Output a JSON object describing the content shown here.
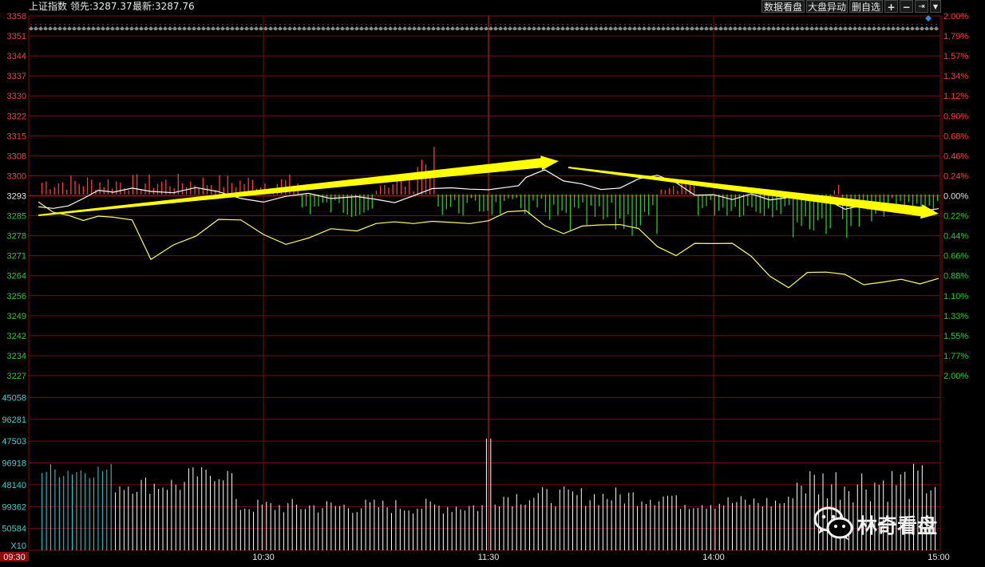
{
  "header": {
    "title": "上证指数",
    "lead_label": "领先:",
    "lead_value": "3287.37",
    "latest_label": "最新:",
    "latest_value": "3287.76"
  },
  "toolbar": {
    "data_label": "数据看盘",
    "move_label": "大盘异动",
    "delete_label": "删自选",
    "plus_label": "+",
    "minus_label": "−",
    "last_label": "⇥",
    "drop_label": "▼"
  },
  "watermark": {
    "text": "林奇看盘",
    "icon": "wechat-icon"
  },
  "colors": {
    "up": "#ff3b3b",
    "down": "#29c829",
    "grid": "#7a0e0e",
    "price_line": "#ffffff",
    "lead_line": "#ffff66",
    "arrow": "#ffff00",
    "volume": "#ffffff",
    "cyan_label": "#3dd2d2",
    "marker": "#2e8fd8"
  },
  "chart_data": {
    "type": "line",
    "price_axis": {
      "ticks": [
        "3358",
        "3351",
        "3344",
        "3337",
        "3330",
        "3322",
        "3315",
        "3308",
        "3300",
        "3293",
        "3285",
        "3278",
        "3271",
        "3264",
        "3256",
        "3249",
        "3242",
        "3234",
        "3227"
      ],
      "pct_ticks": [
        "2.00%",
        "1.79%",
        "1.57%",
        "1.34%",
        "1.12%",
        "0.90%",
        "0.68%",
        "0.46%",
        "0.24%",
        "0.00%",
        "0.22%",
        "0.44%",
        "0.66%",
        "0.88%",
        "1.10%",
        "1.33%",
        "1.55%",
        "1.77%",
        "2.00%"
      ],
      "ylim": [
        3227,
        3358
      ],
      "baseline": 3293
    },
    "volume_axis": {
      "ticks": [
        "45058",
        "96281",
        "47503",
        "96918",
        "48140",
        "99362",
        "50584"
      ],
      "multiplier_label": "X10"
    },
    "x_ticks": [
      "09:30",
      "10:30",
      "11:30",
      "14:00",
      "15:00"
    ],
    "series": [
      {
        "x": [
          0,
          4,
          8,
          12,
          16,
          20,
          25,
          30,
          36,
          42,
          48,
          54,
          60,
          66,
          72,
          78,
          85,
          90,
          95,
          100,
          105,
          110,
          115,
          120,
          125,
          128,
          130,
          135,
          140,
          145,
          150,
          155,
          160,
          165,
          170,
          175,
          180,
          185,
          190,
          195,
          200,
          205,
          210,
          215,
          220,
          225,
          230,
          235,
          240
        ],
        "values": [
          3288.5,
          3287.9,
          3288.8,
          3291.5,
          3294.5,
          3293.8,
          3295.3,
          3294.1,
          3293.6,
          3295.5,
          3294.0,
          3291.5,
          3290.2,
          3292.3,
          3293.4,
          3291.5,
          3292.2,
          3291.2,
          3290.0,
          3292.5,
          3295.1,
          3295.4,
          3294.9,
          3294.7,
          3295.6,
          3296.2,
          3299.2,
          3302.0,
          3297.9,
          3296.8,
          3294.8,
          3295.3,
          3298.7,
          3300.0,
          3297.3,
          3292.7,
          3292.9,
          3291.1,
          3293.2,
          3291.0,
          3291.9,
          3292.5,
          3291.2,
          3287.6,
          3289.2,
          3288.8,
          3287.1,
          3286.9,
          3287.8
        ]
      },
      {
        "x": [
          0,
          4,
          8,
          12,
          16,
          20,
          25,
          30,
          36,
          42,
          48,
          54,
          60,
          66,
          72,
          78,
          85,
          90,
          95,
          100,
          105,
          110,
          115,
          120,
          125,
          130,
          135,
          140,
          145,
          150,
          155,
          160,
          165,
          170,
          175,
          180,
          185,
          190,
          195,
          200,
          205,
          210,
          215,
          220,
          225,
          230,
          235,
          240
        ],
        "values": [
          3290.3,
          3286.5,
          3285.4,
          3283.5,
          3285.1,
          3284.7,
          3283.7,
          3269.3,
          3274.6,
          3277.8,
          3283.9,
          3283.7,
          3278.4,
          3274.8,
          3277.1,
          3280.5,
          3279.7,
          3282.4,
          3283.0,
          3282.4,
          3283.2,
          3282.8,
          3282.4,
          3283.4,
          3286.7,
          3287.1,
          3281.6,
          3278.7,
          3281.5,
          3281.9,
          3282.0,
          3280.6,
          3274.0,
          3270.7,
          3275.2,
          3275.1,
          3275.2,
          3270.5,
          3263.2,
          3259.0,
          3264.6,
          3264.7,
          3263.9,
          3260.1,
          3261.0,
          3262.1,
          3260.4,
          3262.4
        ]
      }
    ],
    "legend": "none",
    "grid": true
  }
}
